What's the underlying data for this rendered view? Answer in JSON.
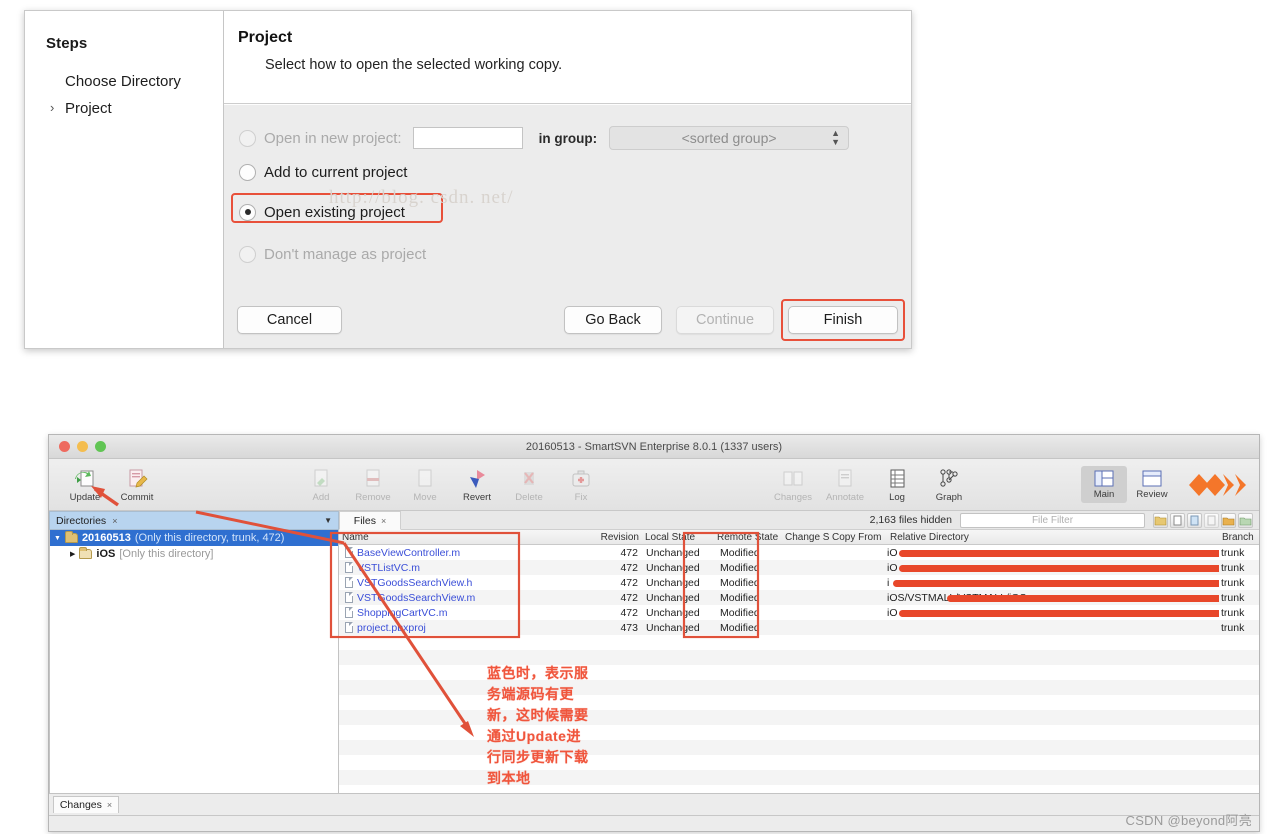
{
  "wizard": {
    "steps_title": "Steps",
    "steps": [
      {
        "label": "Choose Directory",
        "caret": ""
      },
      {
        "label": "Project",
        "caret": "›"
      }
    ],
    "header_title": "Project",
    "header_subtitle": "Select how to open the selected working copy.",
    "options": [
      {
        "label": "Open in new project:",
        "selected": false,
        "disabled": true
      },
      {
        "label": "Add to current project",
        "selected": false,
        "disabled": false
      },
      {
        "label": "Open existing project",
        "selected": true,
        "disabled": false
      },
      {
        "label": "Don't manage as project",
        "selected": false,
        "disabled": true
      }
    ],
    "project_name_value": "",
    "in_group_label": "in group:",
    "group_value": "<sorted group>",
    "buttons": {
      "cancel": "Cancel",
      "go_back": "Go Back",
      "continue": "Continue",
      "finish": "Finish"
    },
    "watermark": "http://blog. csdn. net/",
    "highlight_color": "#e8503a"
  },
  "svn": {
    "window_title": "20160513 - SmartSVN Enterprise 8.0.1 (1337 users)",
    "toolbar_left": [
      {
        "label": "Update",
        "icon": "update-icon",
        "dim": false
      },
      {
        "label": "Commit",
        "icon": "commit-icon",
        "dim": false
      }
    ],
    "toolbar_mid": [
      {
        "label": "Add",
        "icon": "add-icon",
        "dim": true
      },
      {
        "label": "Remove",
        "icon": "remove-icon",
        "dim": true
      },
      {
        "label": "Move",
        "icon": "move-icon",
        "dim": true
      },
      {
        "label": "Revert",
        "icon": "revert-icon",
        "dim": false
      },
      {
        "label": "Delete",
        "icon": "delete-icon",
        "dim": true
      },
      {
        "label": "Fix",
        "icon": "fix-icon",
        "dim": true
      }
    ],
    "toolbar_right": [
      {
        "label": "Changes",
        "icon": "changes-icon",
        "dim": true
      },
      {
        "label": "Annotate",
        "icon": "annotate-icon",
        "dim": true
      },
      {
        "label": "Log",
        "icon": "log-icon",
        "dim": false
      },
      {
        "label": "Graph",
        "icon": "graph-icon",
        "dim": false
      }
    ],
    "view_buttons": [
      {
        "label": "Main",
        "icon": "main-layout-icon",
        "active": true
      },
      {
        "label": "Review",
        "icon": "review-layout-icon",
        "active": false
      }
    ],
    "directories_tab": "Directories",
    "files_tab": "Files",
    "hidden_count": "2,163 files hidden",
    "file_filter_placeholder": "File Filter",
    "dir_tree": [
      {
        "label": "20160513",
        "note": "(Only this directory, trunk, 472)",
        "selected": true,
        "expanded": true
      },
      {
        "label": "iOS",
        "note": "[Only this directory]",
        "selected": false,
        "expanded": false
      }
    ],
    "file_columns": [
      "Name",
      "Revision",
      "Local State",
      "Remote State",
      "Change Set",
      "Copy From",
      "Relative Directory",
      "Branch"
    ],
    "files": [
      {
        "name": "BaseViewController.m",
        "revision": "472",
        "local_state": "Unchanged",
        "remote_state": "Modified",
        "change_set": "",
        "copy_from": "",
        "relative_directory": "iO",
        "branch": "trunk"
      },
      {
        "name": "VSTListVC.m",
        "revision": "472",
        "local_state": "Unchanged",
        "remote_state": "Modified",
        "change_set": "",
        "copy_from": "",
        "relative_directory": "iO",
        "branch": "trunk"
      },
      {
        "name": "VSTGoodsSearchView.h",
        "revision": "472",
        "local_state": "Unchanged",
        "remote_state": "Modified",
        "change_set": "",
        "copy_from": "",
        "relative_directory": "i",
        "branch": "trunk"
      },
      {
        "name": "VSTGoodsSearchView.m",
        "revision": "472",
        "local_state": "Unchanged",
        "remote_state": "Modified",
        "change_set": "",
        "copy_from": "",
        "relative_directory": "iOS/VSTMALL/VSTMALL/iOS",
        "branch": "trunk"
      },
      {
        "name": "ShoppingCartVC.m",
        "revision": "472",
        "local_state": "Unchanged",
        "remote_state": "Modified",
        "change_set": "",
        "copy_from": "",
        "relative_directory": "iO",
        "branch": "trunk"
      },
      {
        "name": "project.pbxproj",
        "revision": "473",
        "local_state": "Unchanged",
        "remote_state": "Modified",
        "change_set": "",
        "copy_from": "",
        "relative_directory": "",
        "branch": "trunk"
      }
    ],
    "changes_tab": "Changes"
  },
  "annotations": {
    "chinese_note_lines": [
      "蓝色时，表示服",
      "务端源码有更",
      "新，这时候需要",
      "通过Update进",
      "行同步更新下载",
      "到本地"
    ],
    "arrow_color": "#e0513a"
  },
  "footer_watermark": "CSDN @beyond阿亮"
}
